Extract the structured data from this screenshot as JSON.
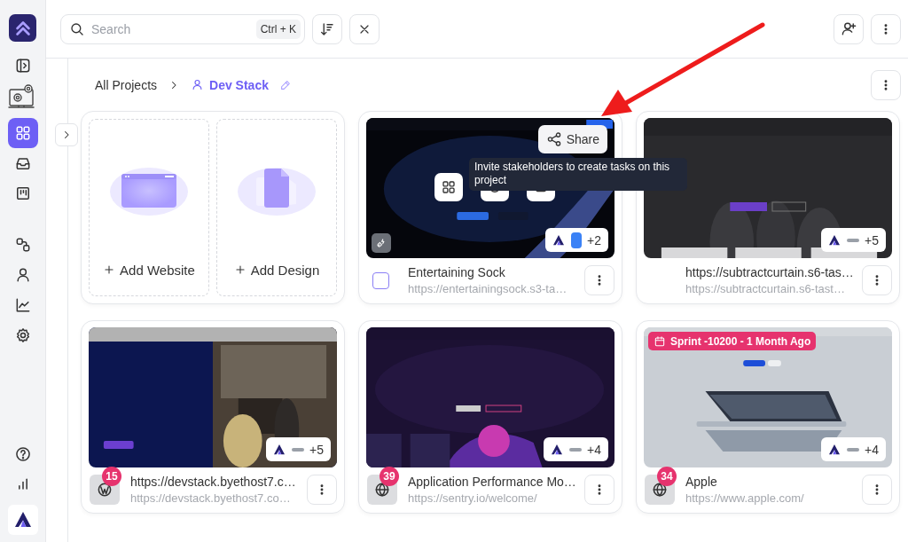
{
  "sidebar": {
    "items": [
      {
        "selected": false
      },
      {
        "selected": false
      },
      {
        "selected": true
      },
      {
        "selected": false
      },
      {
        "selected": false
      },
      {
        "selected": false
      },
      {
        "selected": false
      },
      {
        "selected": false
      },
      {
        "selected": false
      },
      {
        "selected": false
      },
      {
        "selected": false
      }
    ]
  },
  "search": {
    "placeholder": "Search",
    "shortcut": "Ctrl + K"
  },
  "breadcrumb": [
    {
      "label": "All Projects",
      "current": false
    },
    {
      "label": "Dev Stack",
      "current": true
    }
  ],
  "add_card": {
    "tiles": [
      {
        "label": "Add Website"
      },
      {
        "label": "Add Design"
      }
    ]
  },
  "projects": [
    {
      "title": "Entertaining Sock",
      "url": "https://entertainingsock.s3-ta…",
      "reviewers": "+2",
      "leading": {
        "kind": "checkbox",
        "checked": false
      },
      "hovered": true,
      "share": {
        "label": "Share",
        "tooltip": "Invite stakeholders to create tasks on this project"
      }
    },
    {
      "title": "https://subtractcurtain.s6-tas…",
      "url": "https://subtractcurtain.s6-tast…",
      "reviewers": "+5",
      "hovered": false
    },
    {
      "title": "https://devstack.byethost7.c…",
      "url": "https://devstack.byethost7.co…",
      "reviewers": "+5",
      "leading": {
        "kind": "wordpress",
        "count": "15"
      },
      "hovered": false
    },
    {
      "title": "Application Performance Mo…",
      "url": "https://sentry.io/welcome/",
      "reviewers": "+4",
      "leading": {
        "kind": "globe",
        "count": "39"
      },
      "hovered": false
    },
    {
      "title": "Apple",
      "url": "https://www.apple.com/",
      "reviewers": "+4",
      "leading": {
        "kind": "globe",
        "count": "34"
      },
      "hovered": false,
      "sprint": "Sprint -10200 - 1 Month Ago"
    }
  ],
  "annotation": {
    "kind": "arrow"
  }
}
